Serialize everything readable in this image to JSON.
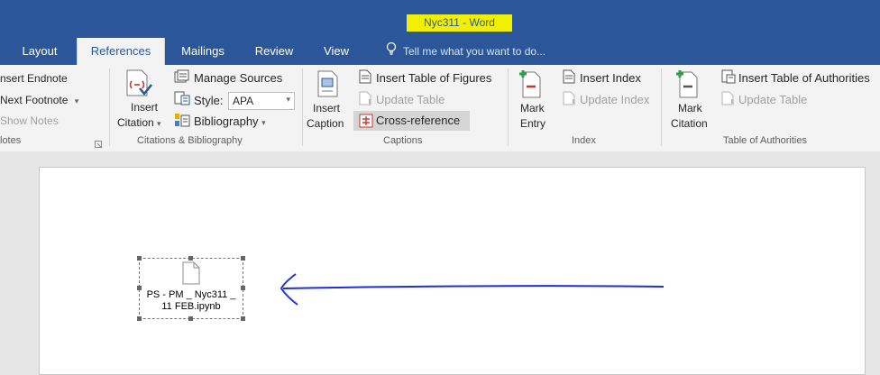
{
  "window": {
    "title": "Nyc311 - Word"
  },
  "tabs": [
    "Layout",
    "References",
    "Mailings",
    "Review",
    "View"
  ],
  "tell_me": {
    "placeholder": "Tell me what you want to do..."
  },
  "ribbon": {
    "footnotes": {
      "insert_endnote": "nsert Endnote",
      "next_footnote": "Next Footnote",
      "show_notes": "Show Notes",
      "group_name": "lotes"
    },
    "citations": {
      "insert_citation_1": "Insert",
      "insert_citation_2": "Citation",
      "manage_sources": "Manage Sources",
      "style_label": "Style:",
      "style_value": "APA",
      "bibliography": "Bibliography",
      "group_name": "Citations & Bibliography"
    },
    "captions": {
      "insert_caption_1": "Insert",
      "insert_caption_2": "Caption",
      "insert_table_of_figures": "Insert Table of Figures",
      "update_table": "Update Table",
      "cross_reference": "Cross-reference",
      "group_name": "Captions"
    },
    "index": {
      "mark_entry_1": "Mark",
      "mark_entry_2": "Entry",
      "insert_index": "Insert Index",
      "update_index": "Update Index",
      "group_name": "Index"
    },
    "authorities": {
      "mark_citation_1": "Mark",
      "mark_citation_2": "Citation",
      "insert_table_of_authorities": "Insert Table of Authorities",
      "update_table": "Update Table",
      "group_name": "Table of Authorities"
    }
  },
  "document": {
    "embedded_file_line1": "PS - PM _ Nyc311 _",
    "embedded_file_line2": "11 FEB.ipynb"
  },
  "colors": {
    "word_blue": "#2b579a",
    "title_highlight": "#f0f000",
    "annotation_arrow": "#1f2fd6"
  }
}
